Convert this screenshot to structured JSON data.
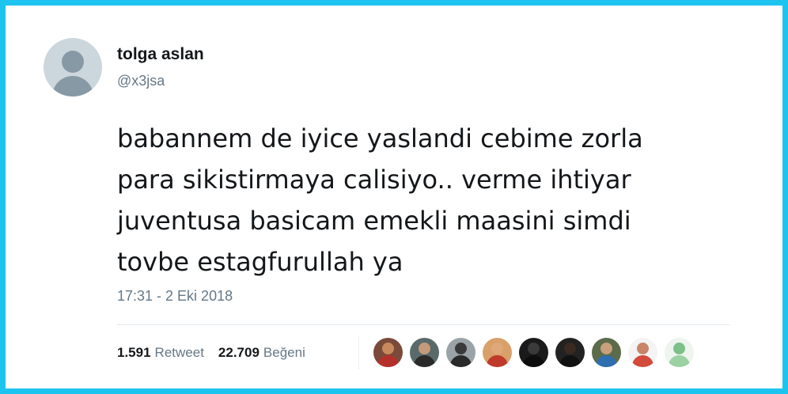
{
  "user": {
    "display_name": "tolga aslan",
    "handle": "@x3jsa",
    "avatar_icon": "default-profile-icon"
  },
  "tweet": {
    "text": "babannem de iyice yaslandi cebime zorla\npara sikistirmaya calisiyo.. verme ihtiyar\njuventusa basicam emekli maasini simdi\ntovbe estagfurullah ya",
    "timestamp": "17:31 - 2 Eki 2018"
  },
  "stats": {
    "retweet_count": "1.591",
    "retweet_label": "Retweet",
    "like_count": "22.709",
    "like_label": "Beğeni"
  },
  "likers": [
    {
      "name": "liker-avatar-1",
      "bg": "#7a4a3a",
      "head": "#c88a5c",
      "body": "#b5302a"
    },
    {
      "name": "liker-avatar-2",
      "bg": "#5a6a6a",
      "head": "#c49a7a",
      "body": "#2a2a2a"
    },
    {
      "name": "liker-avatar-3",
      "bg": "#9aa3a8",
      "head": "#3a3a3a",
      "body": "#2a2a2a"
    },
    {
      "name": "liker-avatar-4",
      "bg": "#d9a06a",
      "head": "#e0a878",
      "body": "#c0392b"
    },
    {
      "name": "liker-avatar-5",
      "bg": "#1a1a1a",
      "head": "#3a3a3a",
      "body": "#0d0d0d"
    },
    {
      "name": "liker-avatar-6",
      "bg": "#222222",
      "head": "#3a2a20",
      "body": "#111111"
    },
    {
      "name": "liker-avatar-7",
      "bg": "#5c6b4a",
      "head": "#c9a07c",
      "body": "#2f6fb0"
    },
    {
      "name": "liker-avatar-8",
      "bg": "#f4f4f4",
      "head": "#c8856a",
      "body": "#d24a3a"
    },
    {
      "name": "liker-avatar-9",
      "bg": "#eef4ee",
      "head": "#7cc08a",
      "body": "#9bd1a3"
    }
  ]
}
